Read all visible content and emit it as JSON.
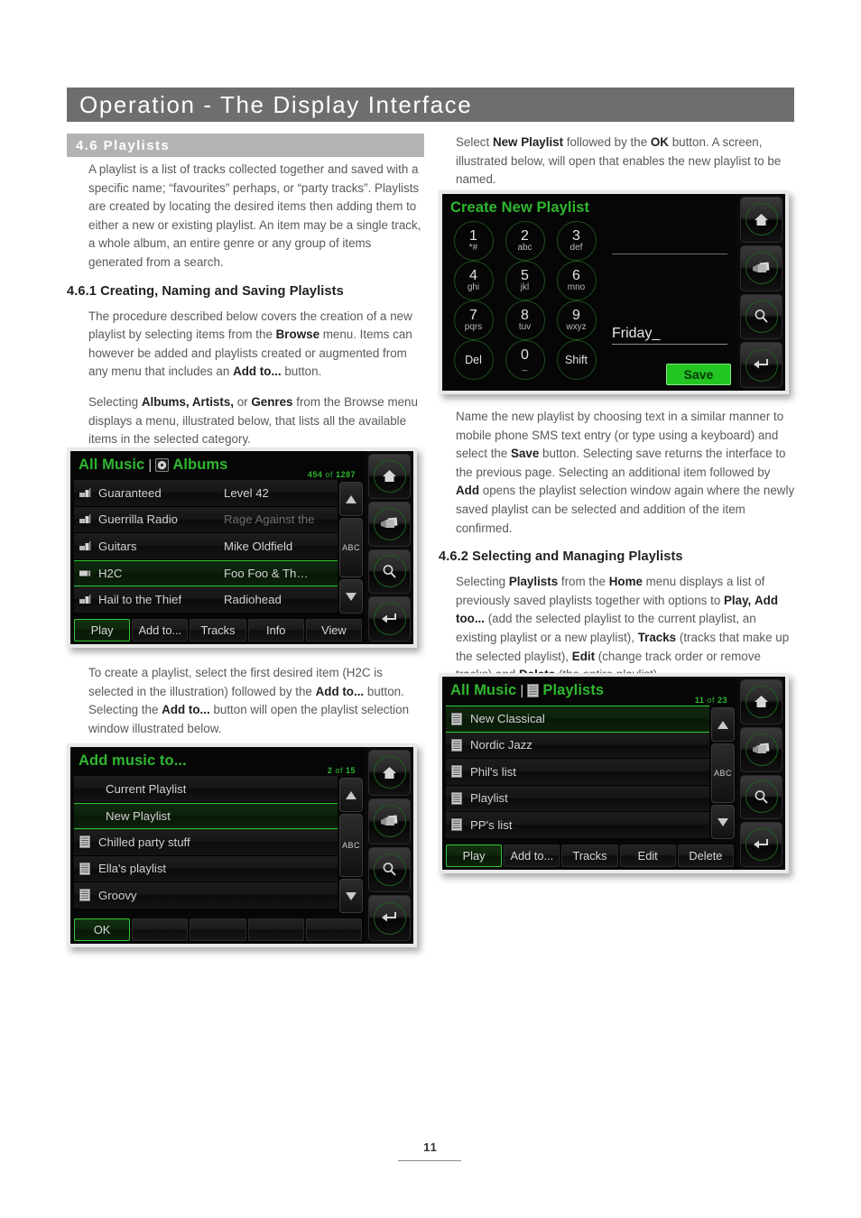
{
  "page": {
    "title": "Operation - The Display Interface",
    "section": "4.6 Playlists",
    "number": "11"
  },
  "left_column": {
    "intro": "A playlist is a list of tracks collected together and saved with a specific name; “favourites” perhaps, or “party tracks”. Playlists are created by locating the desired items then adding them to either a new or existing playlist. An item may be a single track, a whole album, an entire genre or any group of items generated from a search.",
    "subhead_461": "4.6.1 Creating, Naming and Saving Playlists",
    "para_procedure_1": "The procedure described below covers the creation of a new playlist by selecting items from the ",
    "para_procedure_b1": "Browse",
    "para_procedure_2": " menu. Items can however be added and playlists created or augmented from any menu that includes an ",
    "para_procedure_b2": "Add to...",
    "para_procedure_3": " button.",
    "para_selecting_1": "Selecting ",
    "para_selecting_b1": "Albums, Artists,",
    "para_selecting_2": " or ",
    "para_selecting_b2": "Genres",
    "para_selecting_3": " from the Browse menu displays a menu, illustrated below, that lists all the available items in the selected category.",
    "para_create_1": "To create a playlist, select the first desired item (H2C is selected in the illustration) followed by the ",
    "para_create_b1": "Add to...",
    "para_create_2": " button. Selecting the ",
    "para_create_b2": "Add to...",
    "para_create_3": " button will open the playlist selection window illustrated below."
  },
  "right_column": {
    "para_select_1": "Select ",
    "para_select_b1": "New Playlist",
    "para_select_2": " followed by the ",
    "para_select_b2": "OK",
    "para_select_3": " button. A screen, illustrated below, will open that enables the new playlist to be named.",
    "para_name_1": "Name the new playlist by choosing text in a similar manner to mobile phone SMS text entry (or type using a keyboard) and select the ",
    "para_name_b1": "Save",
    "para_name_2": " button. Selecting save returns the interface to the previous page. Selecting an additional item followed by ",
    "para_name_b2": "Add",
    "para_name_3": " opens the playlist selection window again where the newly saved playlist can be selected and addition of the item confirmed.",
    "subhead_462": "4.6.2 Selecting and Managing Playlists",
    "para_manage_1": "Selecting ",
    "para_manage_b1": "Playlists",
    "para_manage_2": " from the ",
    "para_manage_b2": "Home",
    "para_manage_3": " menu displays a list of previously saved playlists together with options to ",
    "para_manage_b3": "Play,",
    "para_manage_4": " ",
    "para_manage_b4": "Add too...",
    "para_manage_5": " (add the selected playlist to the current playlist, an existing playlist or a new playlist), ",
    "para_manage_b5": "Tracks",
    "para_manage_6": " (tracks that make up the selected playlist), ",
    "para_manage_b6": "Edit",
    "para_manage_7": " (change track order or remove tracks) and ",
    "para_manage_b7": "Delete",
    "para_manage_8": " (the entire playlist)",
    "para_manage_b8": "."
  },
  "colors": {
    "accent_green": "#2fb62f",
    "title_bar": "#6e6e6e",
    "section_bar": "#b3b3b3",
    "save_green": "#22c522"
  },
  "side_buttons": [
    {
      "name": "home-icon",
      "label": "Home"
    },
    {
      "name": "cards-icon",
      "label": "Browse"
    },
    {
      "name": "search-icon",
      "label": "Search"
    },
    {
      "name": "return-icon",
      "label": "Return"
    }
  ],
  "screens": {
    "albums": {
      "breadcrumb": "All Music",
      "separator": "|",
      "icon": "disc-icon",
      "title": "Albums",
      "counter_index": "454",
      "counter_of": "of",
      "counter_total": "1287",
      "scroll": {
        "up": "up-arrow",
        "abc": "ABC",
        "down": "down-arrow"
      },
      "rows": [
        {
          "icon": "album-icon",
          "title": "Guaranteed",
          "artist": "Level 42",
          "selected": false,
          "artist_faded": false
        },
        {
          "icon": "album-icon",
          "title": "Guerrilla Radio",
          "artist": "Rage Against the",
          "selected": false,
          "artist_faded": true
        },
        {
          "icon": "album-icon",
          "title": "Guitars",
          "artist": "Mike Oldfield",
          "selected": false,
          "artist_faded": false
        },
        {
          "icon": "album-sel-icon",
          "title": "H2C",
          "artist": "Foo Foo & Th…",
          "selected": true,
          "artist_faded": false
        },
        {
          "icon": "album-icon",
          "title": "Hail to the Thief",
          "artist": "Radiohead",
          "selected": false,
          "artist_faded": false
        }
      ],
      "buttons": [
        {
          "label": "Play",
          "active": true
        },
        {
          "label": "Add to...",
          "active": false
        },
        {
          "label": "Tracks",
          "active": false
        },
        {
          "label": "Info",
          "active": false
        },
        {
          "label": "View",
          "active": false
        }
      ]
    },
    "add_music": {
      "title": "Add music to...",
      "counter_index": "2",
      "counter_of": "of",
      "counter_total": "15",
      "scroll": {
        "up": "up-arrow",
        "abc": "ABC",
        "down": "down-arrow"
      },
      "rows": [
        {
          "icon": "none",
          "title": "Current Playlist",
          "selected": false,
          "indent": true
        },
        {
          "icon": "none",
          "title": "New Playlist",
          "selected": true,
          "indent": true
        },
        {
          "icon": "playlist-icon",
          "title": "Chilled party stuff",
          "selected": false,
          "indent": false
        },
        {
          "icon": "playlist-icon",
          "title": "Ella's playlist",
          "selected": false,
          "indent": false
        },
        {
          "icon": "playlist-icon",
          "title": "Groovy",
          "selected": false,
          "indent": false
        }
      ],
      "buttons": [
        {
          "label": "OK",
          "active": true
        },
        {
          "label": "",
          "active": false
        },
        {
          "label": "",
          "active": false
        },
        {
          "label": "",
          "active": false
        },
        {
          "label": "",
          "active": false
        }
      ]
    },
    "create_playlist": {
      "title": "Create New Playlist",
      "keys": [
        [
          {
            "main": "1",
            "sub": "*#"
          },
          {
            "main": "2",
            "sub": "abc"
          },
          {
            "main": "3",
            "sub": "def"
          }
        ],
        [
          {
            "main": "4",
            "sub": "ghi"
          },
          {
            "main": "5",
            "sub": "jkl"
          },
          {
            "main": "6",
            "sub": "mno"
          }
        ],
        [
          {
            "main": "7",
            "sub": "pqrs"
          },
          {
            "main": "8",
            "sub": "tuv"
          },
          {
            "main": "9",
            "sub": "wxyz"
          }
        ],
        [
          {
            "main": "Del",
            "sub": ""
          },
          {
            "main": "0",
            "sub": "_"
          },
          {
            "main": "Shift",
            "sub": ""
          }
        ]
      ],
      "name_value": "Friday_",
      "save_label": "Save"
    },
    "playlists": {
      "breadcrumb": "All Music",
      "separator": "|",
      "icon": "playlist-icon",
      "title": "Playlists",
      "counter_index": "11",
      "counter_of": "of",
      "counter_total": "23",
      "scroll": {
        "up": "up-arrow",
        "abc": "ABC",
        "down": "down-arrow"
      },
      "rows": [
        {
          "icon": "playlist-icon",
          "title": "New Classical",
          "selected": true
        },
        {
          "icon": "playlist-icon",
          "title": "Nordic Jazz",
          "selected": false
        },
        {
          "icon": "playlist-icon",
          "title": "Phil's list",
          "selected": false
        },
        {
          "icon": "playlist-icon",
          "title": "Playlist",
          "selected": false
        },
        {
          "icon": "playlist-icon",
          "title": "PP's list",
          "selected": false
        }
      ],
      "buttons": [
        {
          "label": "Play",
          "active": true
        },
        {
          "label": "Add to...",
          "active": false
        },
        {
          "label": "Tracks",
          "active": false
        },
        {
          "label": "Edit",
          "active": false
        },
        {
          "label": "Delete",
          "active": false
        }
      ]
    }
  }
}
